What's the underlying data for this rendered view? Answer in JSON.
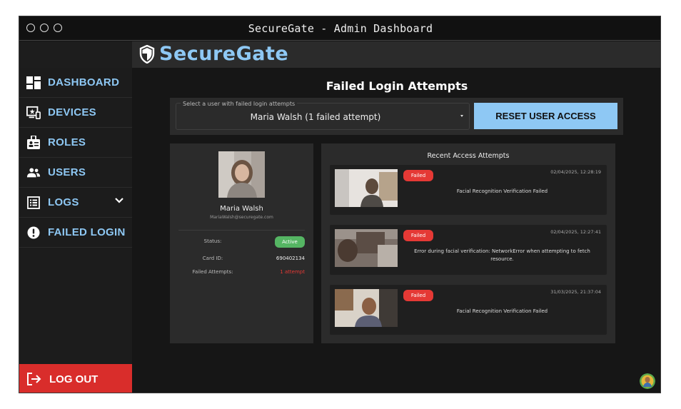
{
  "window": {
    "title": "SecureGate - Admin Dashboard"
  },
  "brand": {
    "name": "SecureGate",
    "accent": "#8ec8f4"
  },
  "sidebar": {
    "items": [
      {
        "label": "DASHBOARD",
        "icon": "dashboard-icon"
      },
      {
        "label": "DEVICES",
        "icon": "devices-icon"
      },
      {
        "label": "ROLES",
        "icon": "roles-icon"
      },
      {
        "label": "USERS",
        "icon": "users-icon"
      },
      {
        "label": "LOGS",
        "icon": "logs-icon"
      },
      {
        "label": "FAILED LOGIN",
        "icon": "alert-icon"
      }
    ],
    "logout_label": "LOG OUT",
    "logout_color": "#d92d2b"
  },
  "main": {
    "title": "Failed Login Attempts",
    "select": {
      "label": "Select a user with failed login attempts",
      "value": "Maria Walsh (1 failed attempt)"
    },
    "reset_button": "RESET USER ACCESS"
  },
  "profile": {
    "name": "Maria Walsh",
    "email": "MariaWalsh@securegate.com",
    "status_label": "Status:",
    "status_value": "Active",
    "card_label": "Card ID:",
    "card_value": "690402134",
    "failed_label": "Failed Attempts:",
    "failed_value": "1 attempt"
  },
  "recent": {
    "title": "Recent Access Attempts",
    "items": [
      {
        "status": "Failed",
        "time": "02/04/2025, 12:28:19",
        "message": "Facial Recognition Verification Failed"
      },
      {
        "status": "Failed",
        "time": "02/04/2025, 12:27:41",
        "message": "Error during facial verification: NetworkError when attempting to fetch resource."
      },
      {
        "status": "Failed",
        "time": "31/03/2025, 21:37:04",
        "message": "Facial Recognition Verification Failed"
      }
    ]
  }
}
